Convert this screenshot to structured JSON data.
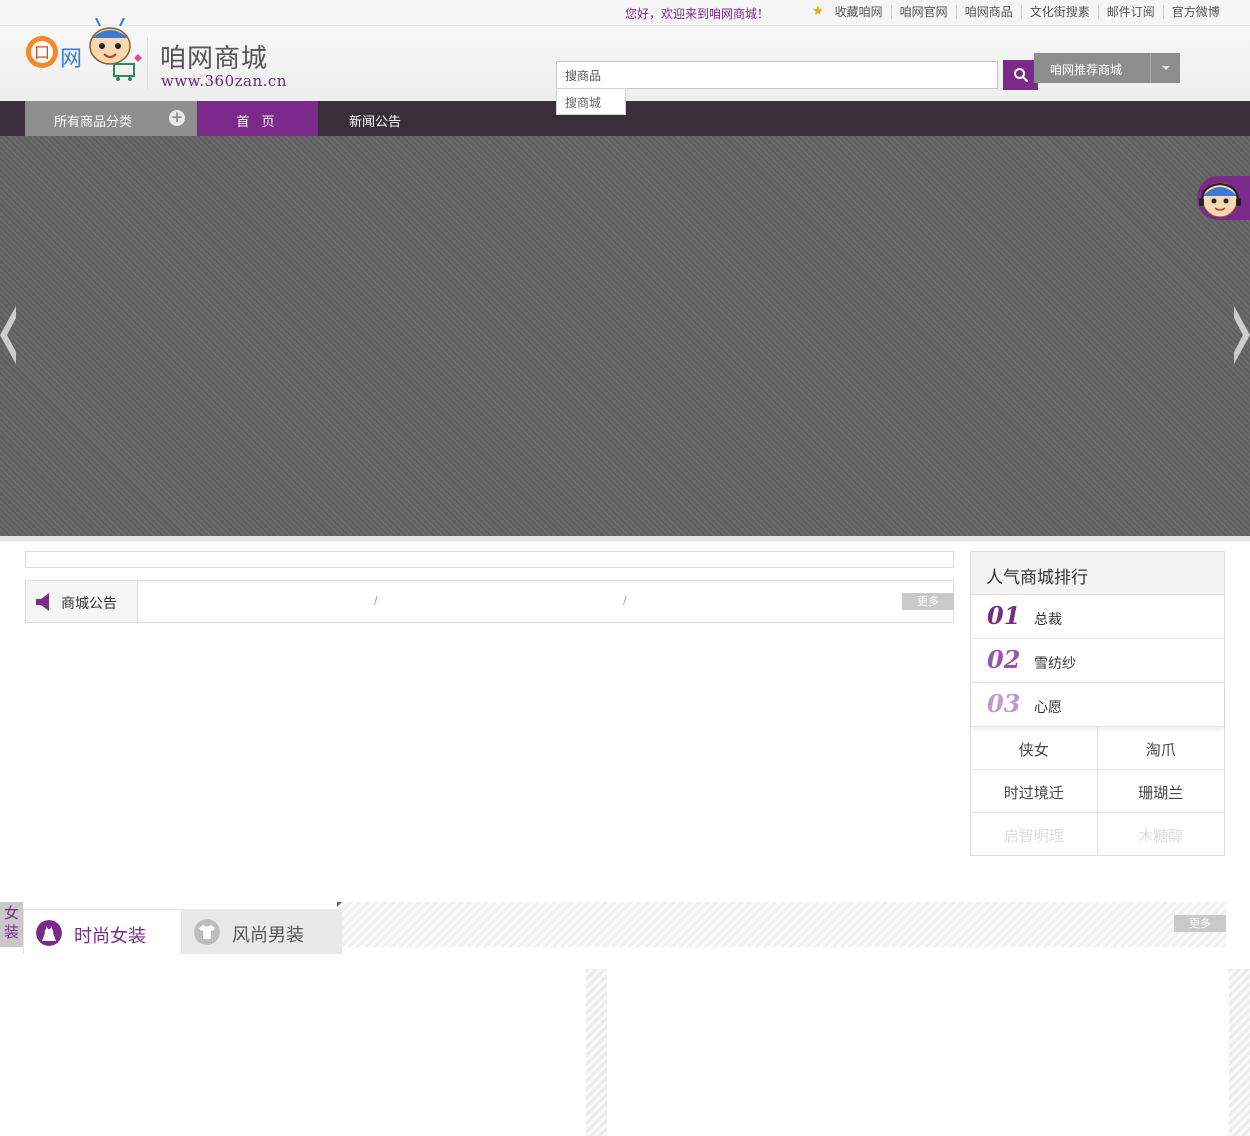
{
  "topbar": {
    "welcome": "您好，欢迎来到咱网商城！",
    "links": [
      "收藏咱网",
      "咱网官网",
      "咱网商品",
      "文化街搜素",
      "邮件订阅",
      "官方微博"
    ]
  },
  "header": {
    "brand": "咱网商城",
    "url": "www.360zan.cn",
    "search_options": [
      "搜商品",
      "搜商城"
    ],
    "recommend_label": "咱网推荐商城"
  },
  "nav": {
    "category_label": "所有商品分类",
    "items": [
      "首 页",
      "新闻公告"
    ]
  },
  "notice": {
    "label": "商城公告",
    "more": "更多"
  },
  "ranking": {
    "title": "人气商城排行",
    "top": [
      {
        "rank": "01",
        "name": "总裁",
        "color": "#7b2a8c"
      },
      {
        "rank": "02",
        "name": "雪纺纱",
        "color": "#9a55aa"
      },
      {
        "rank": "03",
        "name": "心愿",
        "color": "#c298cc"
      }
    ],
    "grid": [
      "侠女",
      "淘爪",
      "时过境迁",
      "珊瑚兰",
      "启智明理",
      "木糖醇"
    ]
  },
  "floor": {
    "side_label": "女装",
    "tabs": [
      "时尚女装",
      "风尚男装"
    ],
    "more": "更多"
  },
  "colors": {
    "brand_purple": "#7b2a8c",
    "nav_dark": "#3a2e3a",
    "gray_button": "#8d8d8d"
  }
}
